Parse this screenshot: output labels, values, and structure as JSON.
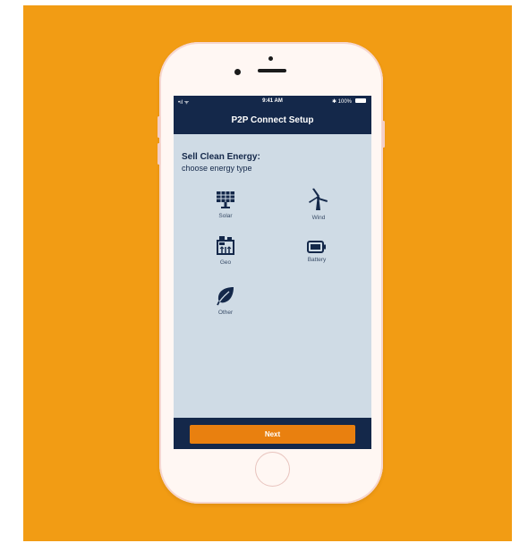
{
  "colors": {
    "background": "#f29c14",
    "nav_bar": "#14284a",
    "screen_bg": "#cfdbe5",
    "accent": "#e9800f",
    "phone_body": "#fff7f3"
  },
  "status_bar": {
    "signal_icon": "signal-wifi-icon",
    "signal_text": "•ıl ᯤ",
    "time": "9:41 AM",
    "battery_text": "✱ 100%",
    "battery_icon": "battery-icon"
  },
  "header": {
    "title": "P2P Connect Setup"
  },
  "main": {
    "heading": "Sell Clean Energy:",
    "subheading": "choose energy type",
    "options": [
      {
        "label": "Solar",
        "icon": "solar-panel-icon"
      },
      {
        "label": "Wind",
        "icon": "wind-turbine-icon"
      },
      {
        "label": "Geo",
        "icon": "geo-plant-icon"
      },
      {
        "label": "Battery",
        "icon": "battery-icon"
      },
      {
        "label": "Other",
        "icon": "leaf-icon"
      }
    ]
  },
  "footer": {
    "next_label": "Next"
  }
}
